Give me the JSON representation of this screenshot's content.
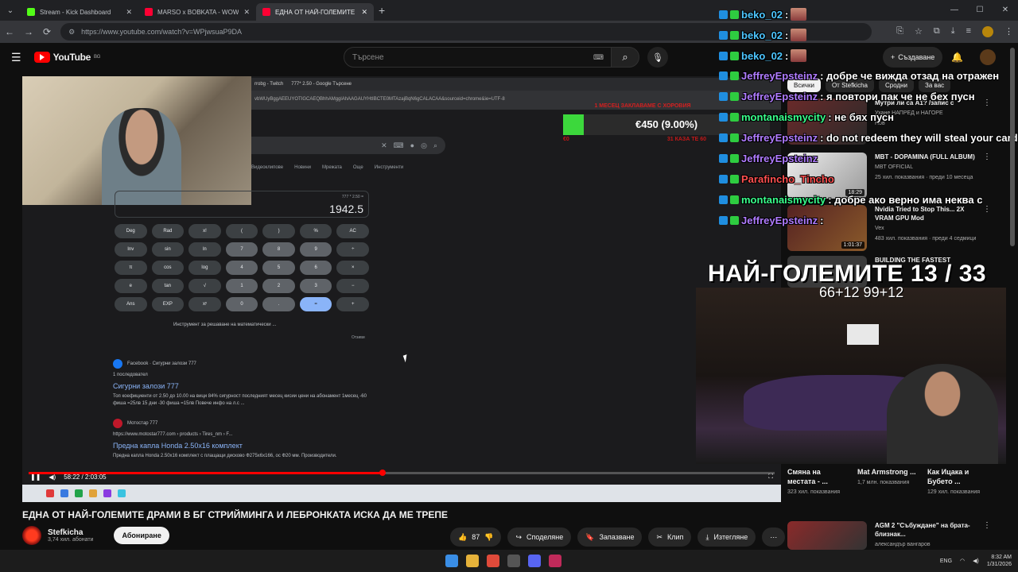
{
  "browser": {
    "tabs": [
      {
        "title": "Stream - Kick Dashboard",
        "color": "#53fc18"
      },
      {
        "title": "MARSO x BOBKATA - WOW (O",
        "color": "#ff0033"
      },
      {
        "title": "ЕДНА ОТ НАЙ-ГОЛЕМИТЕ",
        "color": "#ff0033"
      }
    ],
    "url": "https://www.youtube.com/watch?v=WPjwsuaP9DA"
  },
  "youtube": {
    "logo_text": "YouTube",
    "logo_country": "BG",
    "search_placeholder": "Търсене",
    "create_label": "Създаване",
    "chips": [
      "Всички",
      "От Stefkicha",
      "Сродни",
      "За вас"
    ]
  },
  "player": {
    "time": "58:22 / 2:03:05",
    "progress_fraction": 0.474,
    "inner_tabs": [
      "rrobg - Twitch",
      "777* 2.50 - Google Търсене"
    ],
    "inner_url": "vbWUyBggAEEUYOTIGCAEQBhhAMgglAhAAGAUYHtIBCTE0MTAzajBqN6gCALACAA&sourceid=chrome&ie=UTF-8",
    "donation": {
      "amount": "€450 (9.00%)",
      "fraction": 0.09,
      "header": "1 МЕСЕЦ ЗАКЛАВАМЕ С ХОРОВИЯ",
      "left": "€0",
      "right": "31 КАЗА ТЕ 60"
    },
    "calc": {
      "expr": "777 * 2.50 =",
      "result": "1942.5",
      "keys": [
        "Deg",
        "Rad",
        "x!",
        "(",
        ")",
        "%",
        "AC",
        "Inv",
        "sin",
        "ln",
        "7",
        "8",
        "9",
        "÷",
        "π",
        "cos",
        "log",
        "4",
        "5",
        "6",
        "×",
        "e",
        "tan",
        "√",
        "1",
        "2",
        "3",
        "−",
        "Ans",
        "EXP",
        "xʸ",
        "0",
        ".",
        "=",
        "+"
      ],
      "tool": "Инструмент за решаване на математически ...",
      "feedback": "Отзиви"
    },
    "google_tabs": [
      "Видеоклипове",
      "Новини",
      "Мрежата",
      "Още",
      "Инструменти"
    ],
    "results": [
      {
        "source": "Facebook · Сигурни залози 777",
        "sub": "1 последовател",
        "title": "Сигурни залози 777",
        "snippet": "Топ коефициенти от 2.50 до 10.00 на вици 84% сигурност последният месец кисии цени на абонамент 1месец -60 фиша =25лв 15 дни -30 фиша =15лв Повече инфо на л.с ..."
      },
      {
        "source": "Мотостар 777",
        "sub": "https://www.motostar777.com › products › Tires_nm › F...",
        "title": "Предна капла Honda 2.50x16 комплект",
        "snippet": "Предна капла Honda 2.50x16 комплект с плащащи дисково Ф275х6х166, ос Ф20 мм. Производители."
      }
    ],
    "ad_label": "АВАНТИ"
  },
  "video": {
    "title": "ЕДНА ОТ НАЙ-ГОЛЕМИТЕ ДРАМИ В БГ СТРИЙМИНГА И ЛЕБРОНКАТА ИСКА ДА МЕ ТРЕПЕ",
    "channel": "Stefkicha",
    "subs": "3,74 хил. абонати",
    "subscribe_label": "Абониране",
    "likes": "87",
    "share_label": "Споделяне",
    "save_label": "Запазване",
    "clip_label": "Клип",
    "download_label": "Изтегляне"
  },
  "chat": [
    {
      "user": "beko_02",
      "text": ":",
      "cls": "u-beko"
    },
    {
      "user": "beko_02",
      "text": ":",
      "cls": "u-beko"
    },
    {
      "user": "beko_02",
      "text": ":",
      "cls": "u-beko"
    },
    {
      "user": "JeffreyEpsteinz",
      "text": ": добре че виждa отзад на отражен",
      "cls": "u-jeff"
    },
    {
      "user": "JeffreyEpsteinz",
      "text": ": я повтори пак че не бех пусн",
      "cls": "u-jeff"
    },
    {
      "user": "montanaismycity",
      "text": ": не бях пусн",
      "cls": "u-mont"
    },
    {
      "user": "JeffreyEpsteinz",
      "text": ": do not redeem they will steal your card",
      "cls": "u-jeff"
    },
    {
      "user": "JeffreyEpsteinz",
      "text": "",
      "cls": "u-jeff"
    },
    {
      "user": "Parafincho_Tincho",
      "text": "",
      "cls": "u-para"
    },
    {
      "user": "montanaismycity",
      "text": ": добре ако верно има неква с",
      "cls": "u-mont"
    },
    {
      "user": "JeffreyEpsteinz",
      "text": ":",
      "cls": "u-jeff"
    }
  ],
  "goal": {
    "text": "НАЙ-ГОЛЕМИТЕ 13 / 33",
    "sub": "66+12 99+12"
  },
  "recommendations": [
    {
      "title": "Мутри ли са А1? /запис с",
      "meta": "Уханe НАПРЕД и НАГОРЕ",
      "meta2": "Нов",
      "duration": ""
    },
    {
      "title": "MBT - DOPAMINA (FULL ALBUM)",
      "meta": "MBT OFFICIAL",
      "meta2": "25 хил. показвания · преди 10 месеца",
      "duration": "18:29"
    },
    {
      "title": "Nvidia Tried to Stop This... 2X VRAM GPU Mod",
      "meta": "Vex",
      "meta2": "483 хил. показвания · преди 4 седмици",
      "duration": "1:01:37"
    },
    {
      "title": "BUILDING THE FASTEST",
      "meta": "",
      "meta2": "",
      "duration": ""
    }
  ],
  "shorts": [
    {
      "title": "Смяна на местата - ...",
      "views": "323 хил. показвания"
    },
    {
      "title": "Mat Armstrong ...",
      "views": "1,7 млн. показвания"
    },
    {
      "title": "Как Ицака и Бубето ...",
      "views": "129 хил. показвания"
    }
  ],
  "rec_bottom": {
    "title": "AGM 2 \"Събуждане\" на брата-близнак...",
    "meta": "александър вангаров"
  },
  "taskbar": {
    "time": "8:32 AM",
    "date": "1/31/2026",
    "lang": "ENG"
  }
}
